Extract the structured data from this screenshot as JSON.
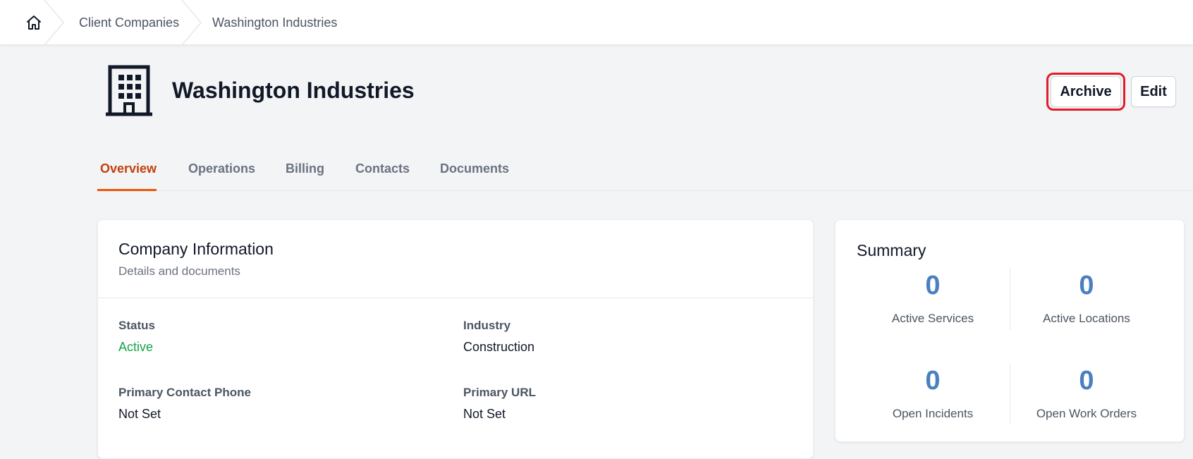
{
  "breadcrumb": {
    "items": [
      {
        "label": "Client Companies"
      },
      {
        "label": "Washington Industries"
      }
    ]
  },
  "header": {
    "title": "Washington Industries",
    "archive_label": "Archive",
    "edit_label": "Edit"
  },
  "tabs": [
    {
      "label": "Overview",
      "active": true
    },
    {
      "label": "Operations",
      "active": false
    },
    {
      "label": "Billing",
      "active": false
    },
    {
      "label": "Contacts",
      "active": false
    },
    {
      "label": "Documents",
      "active": false
    }
  ],
  "company_info": {
    "title": "Company Information",
    "subtitle": "Details and documents",
    "fields": [
      {
        "label": "Status",
        "value": "Active"
      },
      {
        "label": "Industry",
        "value": "Construction"
      },
      {
        "label": "Primary Contact Phone",
        "value": "Not Set"
      },
      {
        "label": "Primary URL",
        "value": "Not Set"
      }
    ]
  },
  "summary": {
    "title": "Summary",
    "stats": [
      {
        "value": "0",
        "label": "Active Services"
      },
      {
        "value": "0",
        "label": "Active Locations"
      },
      {
        "value": "0",
        "label": "Open Incidents"
      },
      {
        "value": "0",
        "label": "Open Work Orders"
      }
    ]
  },
  "colors": {
    "accent": "#ea580c",
    "status_active": "#16a34a",
    "stat_number": "#4a7fc1",
    "highlight_ring": "#e11d2a"
  },
  "icons": {
    "home": "home-icon",
    "company": "building-icon",
    "separator": "chevron-right-icon"
  }
}
